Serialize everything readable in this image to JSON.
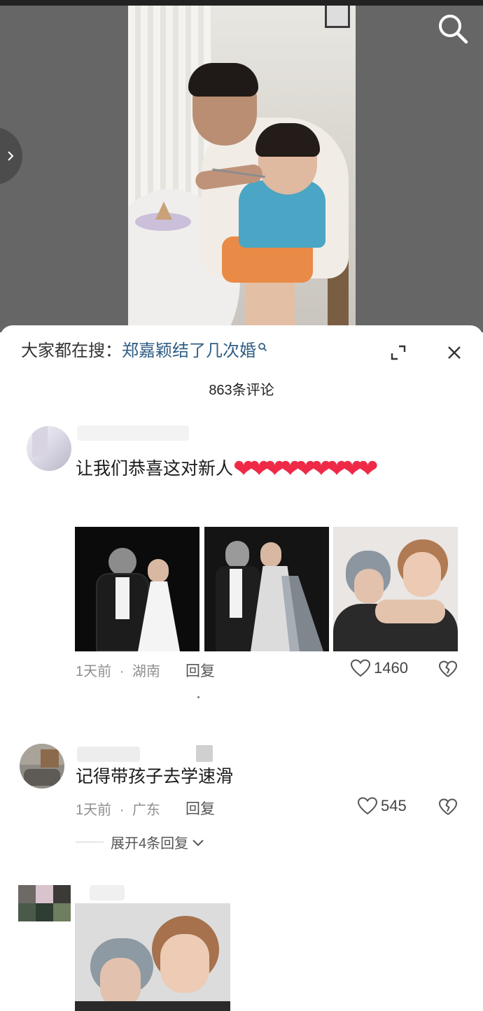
{
  "header": {
    "search_icon": "search-icon",
    "side_tab_icon": "chevron-right-icon"
  },
  "sheet": {
    "hot_search_prefix": "大家都在搜：",
    "hot_search_term": "郑嘉颖结了几次婚",
    "expand_icon": "expand-icon",
    "close_icon": "close-icon",
    "comment_count": "863条评论"
  },
  "comments": [
    {
      "text": "让我们恭喜这对新人",
      "hearts": "❤❤❤❤❤❤❤❤❤",
      "time": "1天前",
      "separator": "·",
      "location": "湖南",
      "reply_label": "回复",
      "likes": "1460"
    },
    {
      "text": "记得带孩子去学速滑",
      "time": "1天前",
      "separator": "·",
      "location": "广东",
      "reply_label": "回复",
      "likes": "545",
      "expand_replies_label": "展开4条回复"
    }
  ],
  "colors": {
    "link": "#2f5c84",
    "heart": "#ee2a48",
    "meta": "#8f8f8f"
  }
}
